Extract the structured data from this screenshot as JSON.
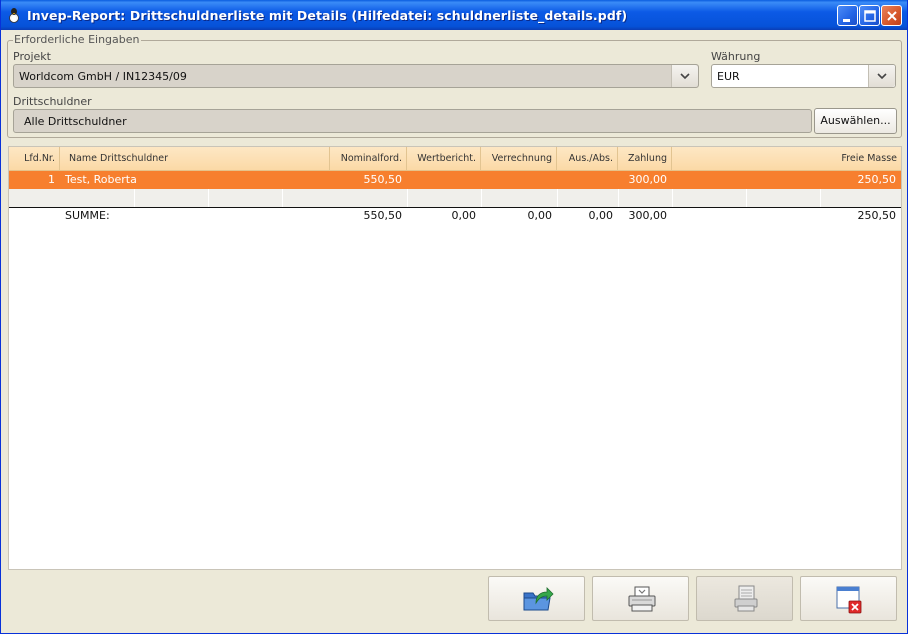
{
  "window": {
    "title": "Invep-Report: Drittschuldnerliste mit Details   (Hilfedatei: schuldnerliste_details.pdf)"
  },
  "inputs": {
    "legend": "Erforderliche Eingaben",
    "projekt_label": "Projekt",
    "projekt_value": "Worldcom GmbH / IN12345/09",
    "waehrung_label": "Währung",
    "waehrung_value": "EUR",
    "drittschuldner_label": "Drittschuldner",
    "drittschuldner_value": "Alle Drittschuldner",
    "auswaehlen_label": "Auswählen..."
  },
  "table": {
    "columns": [
      "Lfd.Nr.",
      "Name Drittschuldner",
      "Nominalford.",
      "Wertbericht.",
      "Verrechnung",
      "Aus./Abs.",
      "Zahlung",
      "Freie Masse"
    ],
    "rows": [
      {
        "nr": "1",
        "name": "Test, Roberta",
        "nominal": "550,50",
        "wert": "",
        "verr": "",
        "aus": "",
        "zahlung": "300,00",
        "frei": "250,50"
      }
    ],
    "sum": {
      "label": "SUMME:",
      "nominal": "550,50",
      "wert": "0,00",
      "verr": "0,00",
      "aus": "0,00",
      "zahlung": "300,00",
      "frei": "250,50"
    }
  },
  "colors": {
    "selected_row": "#f77f2e",
    "header": "#fbd9a6",
    "titlebar": "#0c5ae6"
  },
  "toolbar_icons": [
    "export-icon",
    "print-icon",
    "print-preview-icon",
    "close-window-icon"
  ]
}
